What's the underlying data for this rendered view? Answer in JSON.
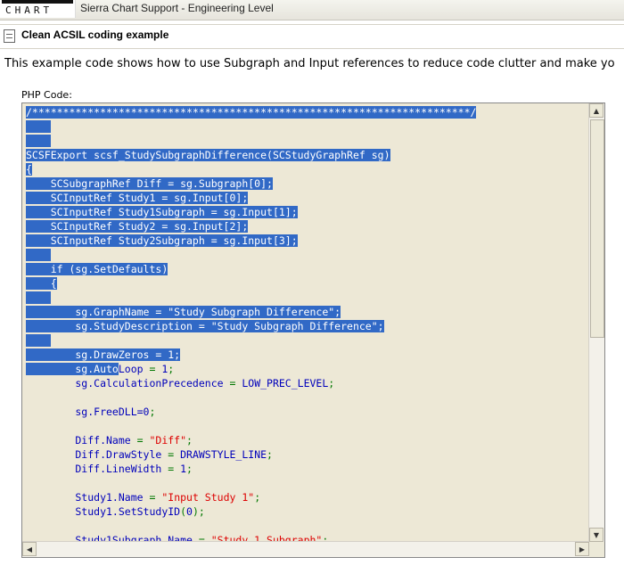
{
  "header": {
    "logo_text": "CHART",
    "site_title": "Sierra Chart Support - Engineering Level"
  },
  "thread": {
    "title": "Clean ACSIL coding example"
  },
  "post": {
    "text": "This example code shows how to use Subgraph and Input references to reduce code clutter and make yo",
    "code_label": "PHP Code:"
  },
  "code": {
    "lines": [
      "/***********************************************************************/",
      "",
      "",
      "SCSFExport scsf_StudySubgraphDifference(SCStudyGraphRef sg)",
      "{",
      "    SCSubgraphRef Diff = sg.Subgraph[0];",
      "    SCInputRef Study1 = sg.Input[0];",
      "    SCInputRef Study1Subgraph = sg.Input[1];",
      "    SCInputRef Study2 = sg.Input[2];",
      "    SCInputRef Study2Subgraph = sg.Input[3];",
      "",
      "    if (sg.SetDefaults)",
      "    {",
      "",
      "        sg.GraphName = \"Study Subgraph Difference\";",
      "        sg.StudyDescription = \"Study Subgraph Difference\";",
      "",
      "        sg.DrawZeros = 1;",
      "        sg.AutoLoop = 1;",
      "        sg.CalculationPrecedence = LOW_PREC_LEVEL;",
      "",
      "        sg.FreeDLL=0;",
      "",
      "        Diff.Name = \"Diff\";",
      "        Diff.DrawStyle = DRAWSTYLE_LINE;",
      "        Diff.LineWidth = 1;",
      "",
      "        Study1.Name = \"Input Study 1\";",
      "        Study1.SetStudyID(0);",
      "",
      "        Study1Subgraph.Name = \"Study 1 Subgraph\";"
    ],
    "selection_line_count": 18,
    "partial_selection": {
      "line": 18,
      "chars": 15
    }
  },
  "scrollbar": {
    "up_arrow": "▲",
    "down_arrow": "▼",
    "left_arrow": "◀",
    "right_arrow": "▶"
  }
}
